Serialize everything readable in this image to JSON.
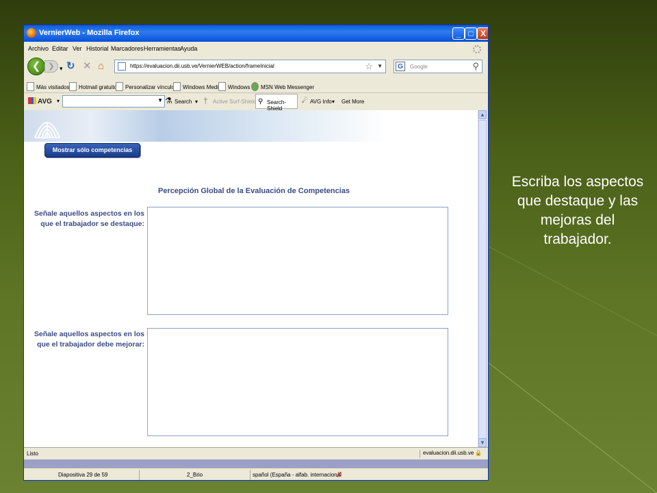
{
  "caption": "Escriba los aspectos que destaque y las mejoras del trabajador.",
  "window": {
    "title": "VernierWeb - Mozilla Firefox",
    "minimize": "_",
    "maximize": "□",
    "close": "X"
  },
  "menu": [
    "Archivo",
    "Editar",
    "Ver",
    "Historial",
    "Marcadores",
    "Herramientas",
    "Ayuda"
  ],
  "nav": {
    "url": "https://evaluacion.dii.usb.ve/VernierWEB/action/frameInicial",
    "search_placeholder": "Google",
    "search_engine_icon": "G"
  },
  "bookmarks": [
    "Más visitados",
    "Hotmail gratuito",
    "Personalizar vínculos",
    "Windows Media",
    "Windows",
    "MSN Web Messenger"
  ],
  "avg_toolbar": {
    "logo": "AVG",
    "search": "Search",
    "active_surf": "Active Surf-Shield",
    "search_shield": "Search-Shield",
    "avg_info": "AVG Info",
    "get_more": "Get More"
  },
  "page": {
    "show_button": "Mostrar sólo competencias",
    "section_title": "Percepción Global de la Evaluación de Competencias",
    "field1_label_line1": "Señale aquellos aspectos en los",
    "field1_label_line2": "que el trabajador se destaque:",
    "field2_label_line1": "Señale aquellos aspectos en los",
    "field2_label_line2": "que el trabajador debe mejorar:"
  },
  "status": {
    "left": "Listo",
    "right": "evaluacion.dii.usb.ve"
  },
  "ppt_status": {
    "slide": "Diapositiva 29 de 59",
    "theme": "2_Brio",
    "language": "spañol (España - alfab. internacional"
  }
}
